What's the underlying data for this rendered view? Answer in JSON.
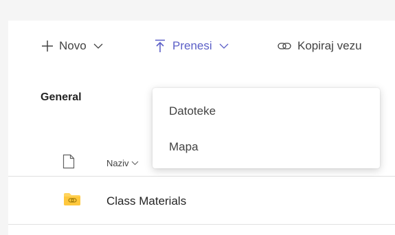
{
  "toolbar": {
    "new_label": "Novo",
    "upload_label": "Prenesi",
    "copy_link_label": "Kopiraj vezu"
  },
  "upload_menu": {
    "items": [
      "Datoteke",
      "Mapa"
    ]
  },
  "channel": {
    "heading": "General"
  },
  "list": {
    "column_name": "Naziv",
    "rows": [
      {
        "name": "Class Materials",
        "type": "folder"
      }
    ]
  },
  "colors": {
    "accent": "#5b5fc7",
    "folder": "#ffd45e",
    "text": "#242424"
  },
  "icons": {
    "new": "plus-icon",
    "upload": "upload-icon",
    "copy": "link-icon",
    "file": "file-icon",
    "folder": "shared-folder-icon"
  }
}
